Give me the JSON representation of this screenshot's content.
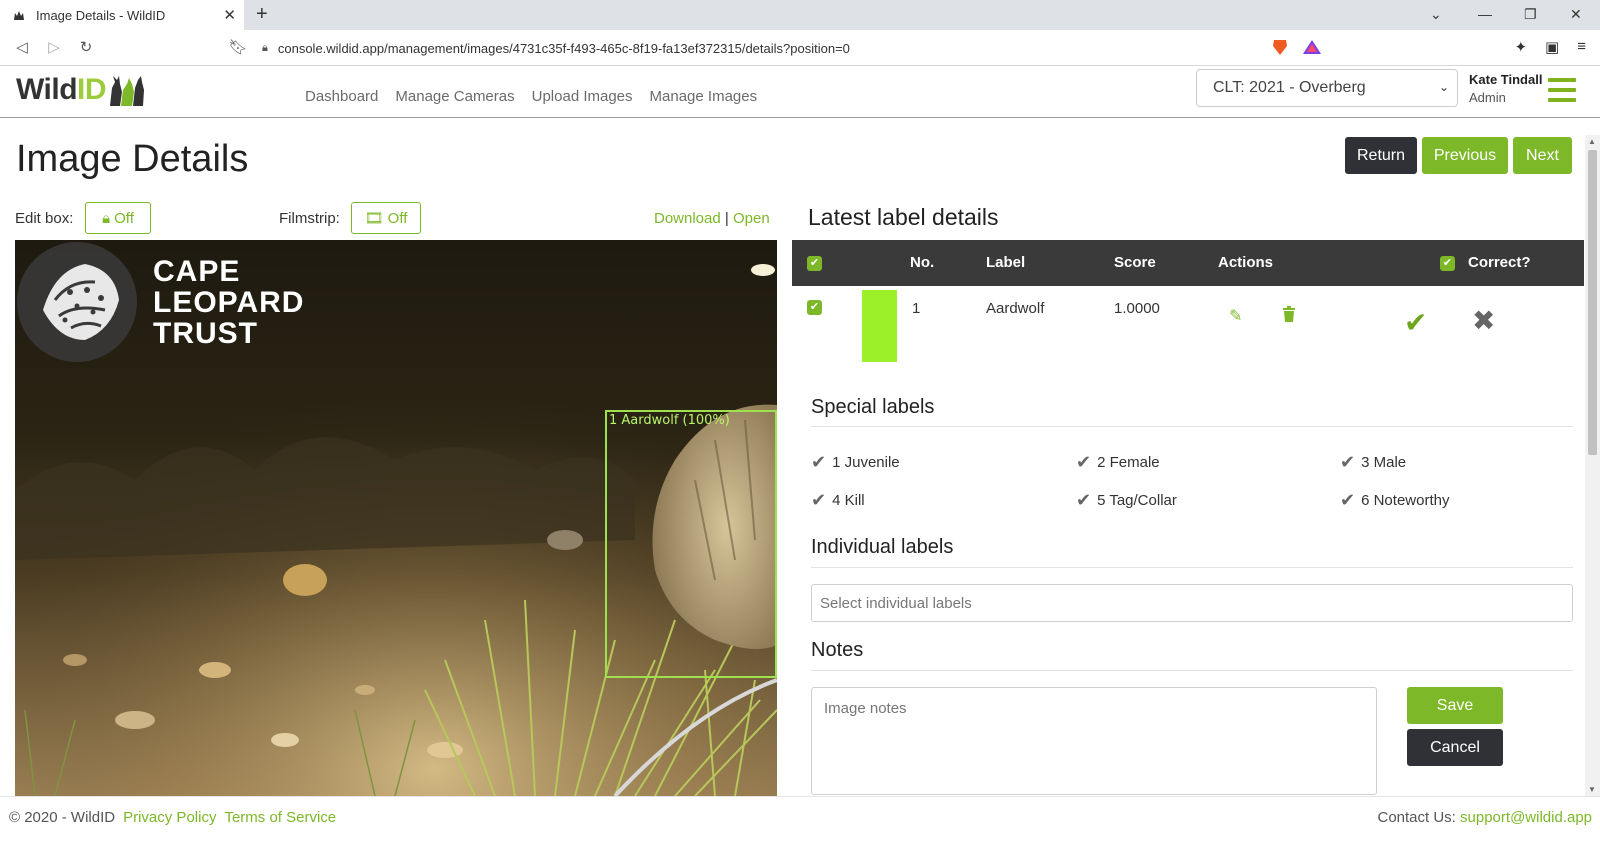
{
  "browser": {
    "tab_title": "Image Details - WildID",
    "url": "console.wildid.app/management/images/4731c35f-f493-465c-8f19-fa13ef372315/details?position=0"
  },
  "header": {
    "logo_text_a": "Wild",
    "logo_text_b": "ID",
    "nav": [
      "Dashboard",
      "Manage Cameras",
      "Upload Images",
      "Manage Images"
    ],
    "project": "CLT: 2021 - Overberg",
    "user_name": "Kate Tindall",
    "user_role": "Admin"
  },
  "page": {
    "title": "Image Details",
    "return_label": "Return",
    "previous_label": "Previous",
    "next_label": "Next",
    "edit_box_label": "Edit box:",
    "edit_box_value": "Off",
    "filmstrip_label": "Filmstrip:",
    "filmstrip_value": "Off",
    "download_label": "Download",
    "link_separator": "|",
    "open_label": "Open"
  },
  "image": {
    "watermark_lines": [
      "CAPE",
      "LEOPARD",
      "TRUST"
    ],
    "detection_label": "1 Aardwolf (100%)"
  },
  "labels": {
    "section_title": "Latest label details",
    "columns": {
      "no": "No.",
      "label": "Label",
      "score": "Score",
      "actions": "Actions",
      "correct": "Correct?"
    },
    "rows": [
      {
        "no": "1",
        "label": "Aardwolf",
        "score": "1.0000",
        "color": "#9cf02a"
      }
    ]
  },
  "special_labels": {
    "title": "Special labels",
    "items": [
      "1 Juvenile",
      "2 Female",
      "3 Male",
      "4 Kill",
      "5 Tag/Collar",
      "6 Noteworthy"
    ]
  },
  "individual_labels": {
    "title": "Individual labels",
    "placeholder": "Select individual labels"
  },
  "notes": {
    "title": "Notes",
    "placeholder": "Image notes",
    "save_label": "Save",
    "cancel_label": "Cancel"
  },
  "footer": {
    "copyright": "© 2020 - WildID",
    "privacy": "Privacy Policy",
    "terms": "Terms of Service",
    "contact_label": "Contact Us:",
    "contact_email": "support@wildid.app"
  },
  "colors": {
    "accent": "#7cb828",
    "dark": "#2f3136"
  }
}
